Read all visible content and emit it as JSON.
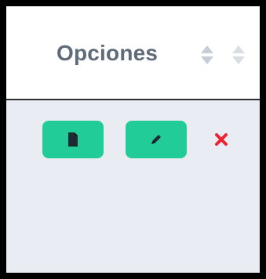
{
  "table": {
    "column_header": {
      "title": "Opciones",
      "sort_icons": [
        "sort-icon",
        "sort-icon"
      ]
    },
    "row": {
      "actions": [
        {
          "name": "view-button",
          "icon": "file-icon"
        },
        {
          "name": "edit-button",
          "icon": "pencil-icon"
        },
        {
          "name": "delete-button",
          "icon": "close-icon"
        }
      ]
    }
  },
  "colors": {
    "action_green": "#22cc99",
    "delete_red": "#ee2233",
    "header_text": "#5f6b78",
    "row_background": "#e9edf3"
  }
}
